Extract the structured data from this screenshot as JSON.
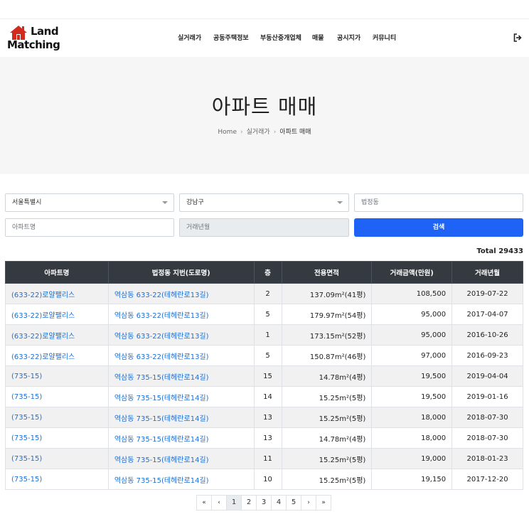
{
  "header": {
    "logo_line1": "Land",
    "logo_line2": "Matching",
    "nav": [
      "실거래가",
      "공동주택정보",
      "부동산중개업체",
      "매물",
      "공시지가",
      "커뮤니티"
    ],
    "logout_icon": "sign-out-icon"
  },
  "hero": {
    "title": "아파트 매매",
    "breadcrumb": [
      "Home",
      "실거래가",
      "아파트 매매"
    ]
  },
  "search": {
    "city": "서울특별시",
    "district": "강남구",
    "dong_placeholder": "법정동",
    "apt_placeholder": "아파트명",
    "date_placeholder": "거래년월",
    "button": "검색"
  },
  "total": "Total 29433",
  "table": {
    "columns": [
      "아파트명",
      "법정동 지번(도로명)",
      "층",
      "전용면적",
      "거래금액(만원)",
      "거래년월"
    ],
    "rows": [
      [
        "(633-22)로얄팰리스",
        "역삼동 633-22(테헤란로13길)",
        "2",
        "137.09m²(41평)",
        "108,500",
        "2019-07-22"
      ],
      [
        "(633-22)로얄팰리스",
        "역삼동 633-22(테헤란로13길)",
        "5",
        "179.97m²(54평)",
        "95,000",
        "2017-04-07"
      ],
      [
        "(633-22)로얄팰리스",
        "역삼동 633-22(테헤란로13길)",
        "1",
        "173.15m²(52평)",
        "95,000",
        "2016-10-26"
      ],
      [
        "(633-22)로얄팰리스",
        "역삼동 633-22(테헤란로13길)",
        "5",
        "150.87m²(46평)",
        "97,000",
        "2016-09-23"
      ],
      [
        "(735-15)",
        "역삼동 735-15(테헤란로14길)",
        "15",
        "14.78m²(4평)",
        "19,500",
        "2019-04-04"
      ],
      [
        "(735-15)",
        "역삼동 735-15(테헤란로14길)",
        "14",
        "15.25m²(5평)",
        "19,500",
        "2019-01-16"
      ],
      [
        "(735-15)",
        "역삼동 735-15(테헤란로14길)",
        "13",
        "15.25m²(5평)",
        "18,000",
        "2018-07-30"
      ],
      [
        "(735-15)",
        "역삼동 735-15(테헤란로14길)",
        "13",
        "14.78m²(4평)",
        "18,000",
        "2018-07-30"
      ],
      [
        "(735-15)",
        "역삼동 735-15(테헤란로14길)",
        "11",
        "15.25m²(5평)",
        "19,000",
        "2018-01-23"
      ],
      [
        "(735-15)",
        "역삼동 735-15(테헤란로14길)",
        "10",
        "15.25m²(5평)",
        "19,150",
        "2017-12-20"
      ]
    ]
  },
  "pagination": {
    "first": "«",
    "prev": "‹",
    "pages": [
      "1",
      "2",
      "3",
      "4",
      "5"
    ],
    "next": "›",
    "last": "»",
    "current": "1"
  },
  "colors": {
    "accent": "#1e63f5",
    "table_header": "#343a40",
    "link": "#1a6fd6"
  }
}
